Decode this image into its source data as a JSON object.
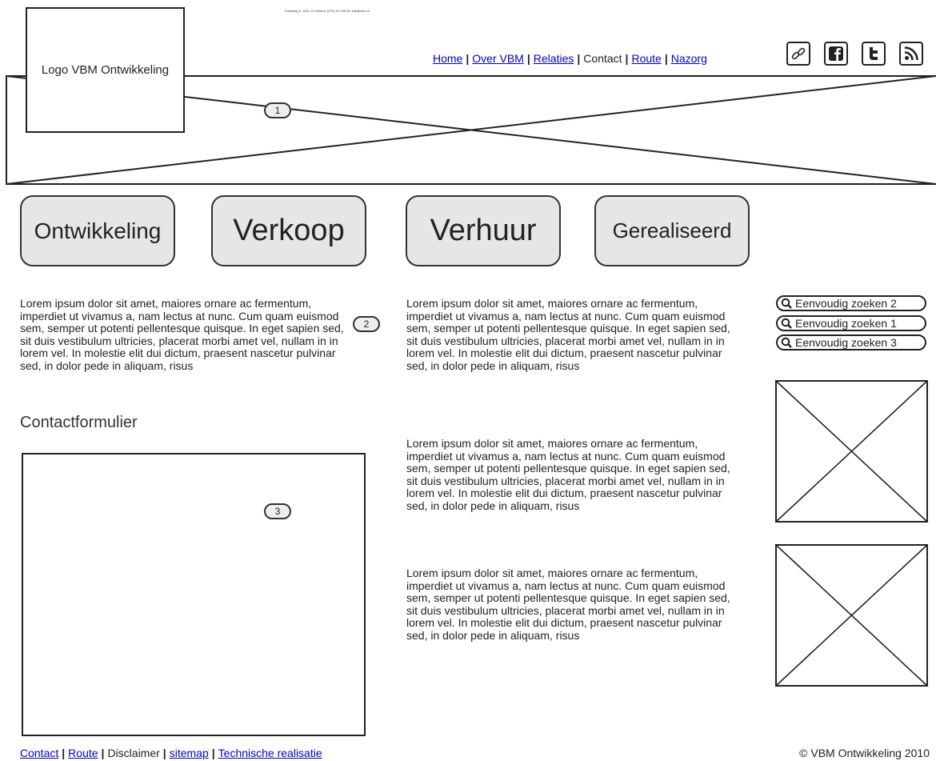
{
  "header": {
    "contact_line": "Kruisweg 5, 1621 XX Almere, (072) 571 88 33, info@vbm.nl",
    "logo_text": "Logo VBM Ontwikkeling",
    "nav": [
      {
        "label": "Home",
        "link": true
      },
      {
        "label": "Over VBM",
        "link": true
      },
      {
        "label": "Relaties",
        "link": true
      },
      {
        "label": "Contact",
        "link": false
      },
      {
        "label": "Route",
        "link": true
      },
      {
        "label": "Nazorg",
        "link": true
      }
    ],
    "social_icons": [
      "link-icon",
      "facebook-icon",
      "twitter-icon",
      "rss-icon"
    ]
  },
  "callouts": {
    "one": "1",
    "two": "2",
    "three": "3"
  },
  "categories": [
    "Ontwikkeling",
    "Verkoop",
    "Verhuur",
    "Gerealiseerd"
  ],
  "content": {
    "intro": "Lorem ipsum dolor sit amet, maiores ornare ac fermentum, imperdiet ut vivamus a, nam lectus at nunc. Cum quam euismod sem, semper ut potenti pellentesque quisque. In eget sapien sed, sit duis vestibulum ultricies, placerat morbi amet vel, nullam in in lorem vel. In molestie elit dui dictum, praesent nascetur pulvinar sed, in dolor pede in aliquam, risus",
    "contact_heading": "Contactformulier",
    "column2": [
      "Lorem ipsum dolor sit amet, maiores ornare ac fermentum, imperdiet ut vivamus a, nam lectus at nunc. Cum quam euismod sem, semper ut potenti pellentesque quisque. In eget sapien sed, sit duis vestibulum ultricies, placerat morbi amet vel, nullam in in lorem vel. In molestie elit dui dictum, praesent nascetur pulvinar sed, in dolor pede in aliquam, risus",
      "Lorem ipsum dolor sit amet, maiores ornare ac fermentum, imperdiet ut vivamus a, nam lectus at nunc. Cum quam euismod sem, semper ut potenti pellentesque quisque. In eget sapien sed, sit duis vestibulum ultricies, placerat morbi amet vel, nullam in in lorem vel. In molestie elit dui dictum, praesent nascetur pulvinar sed, in dolor pede in aliquam, risus",
      "Lorem ipsum dolor sit amet, maiores ornare ac fermentum, imperdiet ut vivamus a, nam lectus at nunc. Cum quam euismod sem, semper ut potenti pellentesque quisque. In eget sapien sed, sit duis vestibulum ultricies, placerat morbi amet vel, nullam in in lorem vel. In molestie elit dui dictum, praesent nascetur pulvinar sed, in dolor pede in aliquam, risus"
    ]
  },
  "sidebar": {
    "search_buttons": [
      "Eenvoudig zoeken 2",
      "Eenvoudig zoeken 1",
      "Eenvoudig zoeken 3"
    ]
  },
  "footer": {
    "links": [
      {
        "label": "Contact",
        "link": true
      },
      {
        "label": "Route",
        "link": true
      },
      {
        "label": "Disclaimer",
        "link": false
      },
      {
        "label": "sitemap",
        "link": true
      },
      {
        "label": "Technische realisatie",
        "link": true
      }
    ],
    "copyright": "© VBM Ontwikkeling 2010"
  }
}
